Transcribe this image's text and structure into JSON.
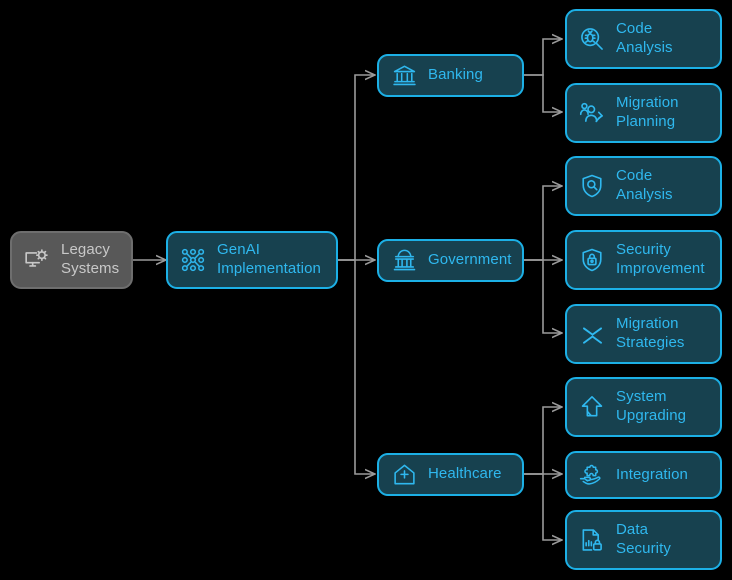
{
  "diagram": {
    "background_color": "#000000",
    "active_node_fill": "#17414f",
    "active_node_border": "#1cb0e6",
    "active_text_color": "#2fb8ef",
    "legacy_node_fill": "#585858",
    "legacy_node_border": "#6e6e6e",
    "legacy_text_color": "#c8c8c8",
    "edge_color": "#9a9a9a"
  },
  "nodes": {
    "legacy_systems": {
      "label": "Legacy\nSystems",
      "icon": "monitor-gear-icon",
      "state": "legacy"
    },
    "genai_implementation": {
      "label": "GenAI\nImplementation",
      "icon": "neural-network-icon",
      "state": "active"
    },
    "banking": {
      "label": "Banking",
      "icon": "bank-building-icon",
      "state": "active"
    },
    "government": {
      "label": "Government",
      "icon": "capitol-building-icon",
      "state": "active"
    },
    "healthcare": {
      "label": "Healthcare",
      "icon": "hospital-house-icon",
      "state": "active"
    },
    "banking_code_analysis": {
      "label": "Code\nAnalysis",
      "icon": "bug-magnifier-icon",
      "state": "active"
    },
    "banking_migration_planning": {
      "label": "Migration\nPlanning",
      "icon": "users-migration-icon",
      "state": "active"
    },
    "government_code_analysis": {
      "label": "Code\nAnalysis",
      "icon": "shield-magnifier-icon",
      "state": "active"
    },
    "government_security_improvement": {
      "label": "Security\nImprovement",
      "icon": "shield-lock-icon",
      "state": "active"
    },
    "government_migration_strategies": {
      "label": "Migration\nStrategies",
      "icon": "compress-chevrons-icon",
      "state": "active"
    },
    "healthcare_system_upgrading": {
      "label": "System\nUpgrading",
      "icon": "upgrade-arrow-icon",
      "state": "active"
    },
    "healthcare_integration": {
      "label": "Integration",
      "icon": "hand-puzzle-icon",
      "state": "active"
    },
    "healthcare_data_security": {
      "label": "Data\nSecurity",
      "icon": "document-lock-icon",
      "state": "active"
    }
  }
}
